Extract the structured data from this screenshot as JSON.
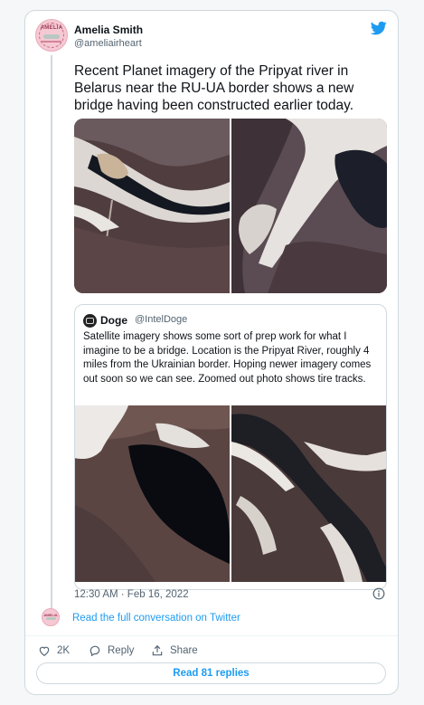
{
  "author": {
    "name": "Amelia Smith",
    "handle": "@ameliairheart",
    "avatar_wordmark": "AMELIA"
  },
  "tweet": {
    "text": "Recent Planet imagery of the Pripyat river in Belarus near the RU-UA border shows a new bridge having been constructed earlier today.",
    "timestamp": "12:30 AM · Feb 16, 2022",
    "images": [
      "satellite-image-bridge-closeup",
      "satellite-image-river-bend"
    ]
  },
  "quoted_tweet": {
    "name": "Doge",
    "handle": "@IntelDoge",
    "text": "Satellite imagery shows some sort of prep work for what I imagine to be a bridge. Location is the Pripyat River, roughly 4 miles from the Ukrainian border. Hoping newer imagery comes out soon so we can see. Zoomed out photo shows tire tracks.",
    "images": [
      "satellite-image-snowy-riverbank",
      "satellite-image-zoomed-out-river"
    ]
  },
  "links": {
    "full_conversation": "Read the full conversation on Twitter"
  },
  "actions": {
    "likes_count": "2K",
    "reply_label": "Reply",
    "share_label": "Share",
    "read_replies": "Read 81 replies"
  },
  "icons": {
    "brand": "twitter-bird-icon",
    "info": "info-icon",
    "like": "heart-icon",
    "reply": "speech-bubble-icon",
    "share": "share-upload-icon"
  },
  "colors": {
    "accent": "#1d9bf0",
    "text_primary": "#0f1419",
    "text_secondary": "#536471",
    "border": "#cfd9de"
  }
}
